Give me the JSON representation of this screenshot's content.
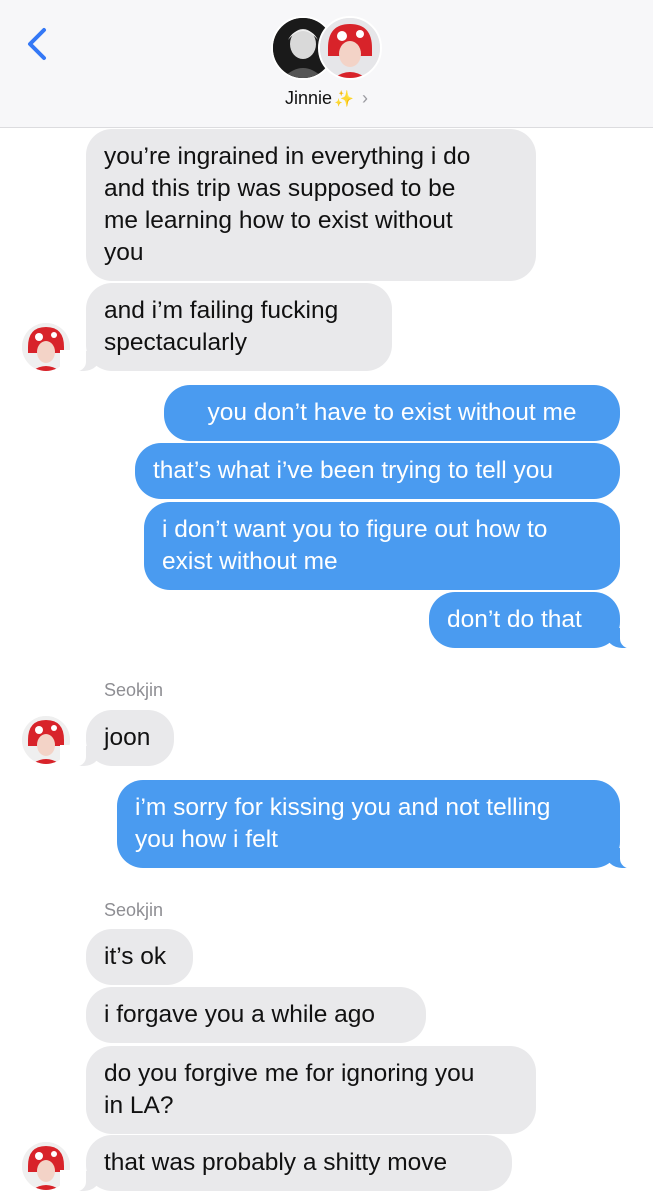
{
  "header": {
    "contact_name": "Jinnie",
    "sparkle": "✨",
    "chevron": "›",
    "back_icon": "chevron-left-icon"
  },
  "colors": {
    "incoming": "#e9e9eb",
    "outgoing": "#4a9bf0",
    "accent": "#3478f6"
  },
  "messages": [
    {
      "from": "them",
      "lines": [
        "you’re ingrained in everything i do",
        "and this trip was supposed to be",
        "me learning how to exist without",
        "you"
      ]
    },
    {
      "from": "them",
      "lines": [
        "and i’m failing fucking",
        "spectacularly"
      ]
    },
    {
      "from": "me",
      "lines": [
        "you don’t have to exist without me"
      ]
    },
    {
      "from": "me",
      "lines": [
        "that’s what i’ve been trying to tell you"
      ]
    },
    {
      "from": "me",
      "lines": [
        "i don’t want you to figure out how to",
        "exist without me"
      ]
    },
    {
      "from": "me",
      "lines": [
        "don’t do that"
      ]
    },
    {
      "from": "them",
      "sender": "Seokjin",
      "lines": [
        "joon"
      ]
    },
    {
      "from": "me",
      "lines": [
        "i’m sorry for kissing you and not telling",
        "you how i felt"
      ]
    },
    {
      "from": "them",
      "sender": "Seokjin",
      "lines": [
        "it’s ok"
      ]
    },
    {
      "from": "them",
      "lines": [
        "i forgave you a while ago"
      ]
    },
    {
      "from": "them",
      "lines": [
        "do you forgive me for ignoring you",
        "in LA?"
      ]
    },
    {
      "from": "them",
      "lines": [
        "that was probably a shitty move"
      ]
    }
  ]
}
